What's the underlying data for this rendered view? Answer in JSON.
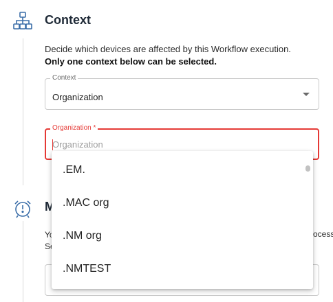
{
  "context_section": {
    "title": "Context",
    "description": "Decide which devices are affected by this Workflow execution.",
    "description_strong": "Only one context below can be selected.",
    "context_field": {
      "label": "Context",
      "value": "Organization"
    },
    "organization_field": {
      "label": "Organization *",
      "placeholder": "Organization",
      "value": ""
    }
  },
  "second_section": {
    "title_visible": "M",
    "text_line1": "Yo",
    "text_line2": "Se",
    "text_right": "ocess"
  },
  "dropdown": {
    "options": [
      ".EM.",
      ".MAC org",
      ".NM org",
      ".NMTEST"
    ]
  },
  "colors": {
    "accent_icon": "#3b6ea8",
    "error": "#e53935"
  },
  "icons": {
    "context": "sitemap-icon",
    "maintenance": "alarm-clock-icon"
  }
}
